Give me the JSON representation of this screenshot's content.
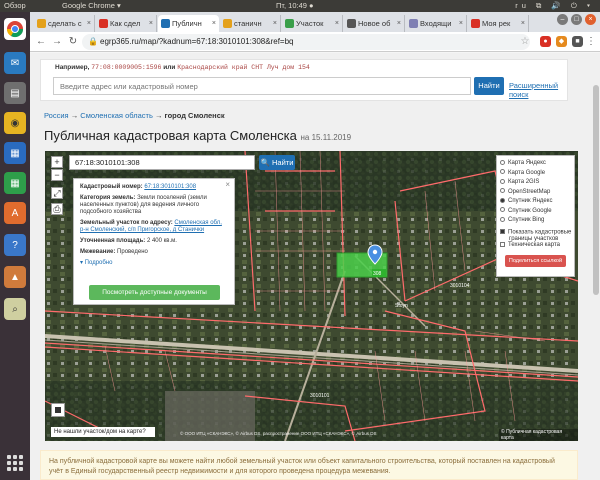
{
  "topbar": {
    "overview": "Обзор",
    "app": "Google Chrome ▾",
    "clock": "Пт, 10:49 ●",
    "tray": "ru ⧉ 🔊 ⏻ ▾"
  },
  "tabs": [
    {
      "label": "сделать с",
      "color": "#e4a11b"
    },
    {
      "label": "Как сдел",
      "color": "#d93025"
    },
    {
      "label": "Публичн",
      "color": "#1f6fb2"
    },
    {
      "label": "станичн",
      "color": "#e4a11b"
    },
    {
      "label": "Участок",
      "color": "#3a9f4a"
    },
    {
      "label": "Новое об",
      "color": "#555555"
    },
    {
      "label": "Входящи",
      "color": "#7f7fb3"
    },
    {
      "label": "Моя рек",
      "color": "#d93025"
    }
  ],
  "nav": {
    "url": "egrp365.ru/map/?kadnum=67:18:3010101:308&ref=bq"
  },
  "search": {
    "example_prefix": "Например,",
    "example_1": "77:08:0009005:1596",
    "example_or": "или",
    "example_2": "Краснодарский край СНТ Луч дом 154",
    "placeholder": "Введите адрес или кадастровый номер",
    "find": "Найти",
    "advanced": "Расширенный поиск"
  },
  "breadcrumb": {
    "russia": "Россия",
    "arrow": "→",
    "region": "Смоленская область",
    "city": "город Смоленск"
  },
  "title": {
    "main": "Публичная кадастровая карта Смоленска",
    "date": "на 15.11.2019"
  },
  "map": {
    "search_value": "67:18:3010101:308",
    "find": "🔍 Найти",
    "zoom_in": "+",
    "zoom_out": "−",
    "popup": {
      "close": "×",
      "cad_label": "Кадастровый номер:",
      "cad_value": "67:18:3010101:308",
      "cat_label": "Категория земель:",
      "cat_value": "Земли поселений (земли населенных пунктов) для ведения личного подсобного хозяйства",
      "addr_label": "Земельный участок по адресу:",
      "addr_value": "Смоленская обл, р-н Смоленский, с/п Пригорское, д Станички",
      "area_label": "Уточненная площадь:",
      "area_value": "2 400 кв.м.",
      "border_label": "Межевание:",
      "border_value": "Проведено",
      "more": "▾ Подробно",
      "docs": "Посмотреть доступные документы"
    },
    "layers": [
      {
        "label": "Карта Яндекс",
        "on": false
      },
      {
        "label": "Карта Google",
        "on": false
      },
      {
        "label": "Карта 2GIS",
        "on": false
      },
      {
        "label": "OpenStreetMap",
        "on": false
      },
      {
        "label": "Спутник Яндекс",
        "on": true
      },
      {
        "label": "Спутник Google",
        "on": false
      },
      {
        "label": "Спутник Bing",
        "on": false
      }
    ],
    "show_borders_1": "Показать кадастровые",
    "show_borders_2": "границы участков",
    "tech_map": "Техническая карта",
    "share": "Поделиться ссылкой",
    "not_found": "Не нашли участок/дом на карте?",
    "copyright": "© ООО ИТЦ «СКАНЭКС», © Airbus DS, распространение ООО ИТЦ «СКАНЭКС», © Airbus DS",
    "pkk": "© Публичная кадастровая карта",
    "labels": [
      "308",
      "3010101",
      "3010104",
      "Stoyn"
    ]
  },
  "info": {
    "text": "На публичной кадастровой карте вы можете найти любой земельный участок или объект капитального строительства, который поставлен на кадастровый учёт в Единый государственный реестр недвижимости и для которого проведена процедура межевания."
  }
}
